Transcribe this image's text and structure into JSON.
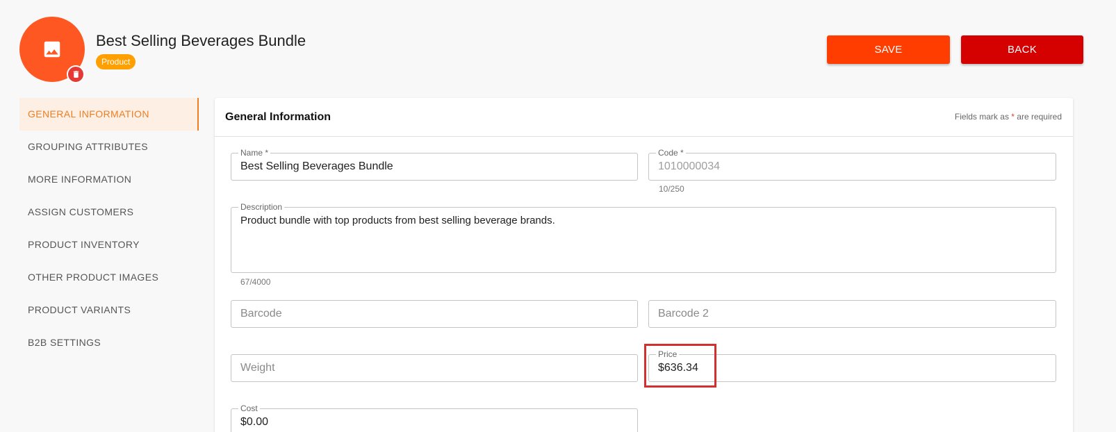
{
  "header": {
    "title": "Best Selling Beverages Bundle",
    "type_badge": "Product",
    "save_label": "SAVE",
    "back_label": "BACK",
    "avatar_icon": "image-icon",
    "delete_icon": "trash-icon"
  },
  "sidebar": {
    "items": [
      {
        "label": "GENERAL INFORMATION",
        "active": true
      },
      {
        "label": "GROUPING ATTRIBUTES"
      },
      {
        "label": "MORE INFORMATION"
      },
      {
        "label": "ASSIGN CUSTOMERS"
      },
      {
        "label": "PRODUCT INVENTORY"
      },
      {
        "label": "OTHER PRODUCT IMAGES"
      },
      {
        "label": "PRODUCT VARIANTS"
      },
      {
        "label": "B2B SETTINGS"
      }
    ]
  },
  "card": {
    "title": "General Information",
    "required_note_prefix": "Fields mark as ",
    "required_star": "*",
    "required_note_suffix": " are required"
  },
  "form": {
    "name": {
      "label": "Name *",
      "value": "Best Selling Beverages Bundle"
    },
    "code": {
      "label": "Code *",
      "value": "1010000034",
      "counter": "10/250"
    },
    "description": {
      "label": "Description",
      "value": "Product bundle with top products from best selling beverage brands.",
      "counter": "67/4000"
    },
    "barcode": {
      "placeholder": "Barcode"
    },
    "barcode2": {
      "placeholder": "Barcode 2"
    },
    "weight": {
      "placeholder": "Weight"
    },
    "price": {
      "label": "Price",
      "value": "$636.34"
    },
    "cost": {
      "label": "Cost",
      "value": "$0.00"
    }
  },
  "colors": {
    "accent": "#ef7d22",
    "avatar": "#ff5722",
    "save": "#ff3d00",
    "back": "#d50000",
    "badge": "#ffa000",
    "highlight": "#d32f2f"
  }
}
